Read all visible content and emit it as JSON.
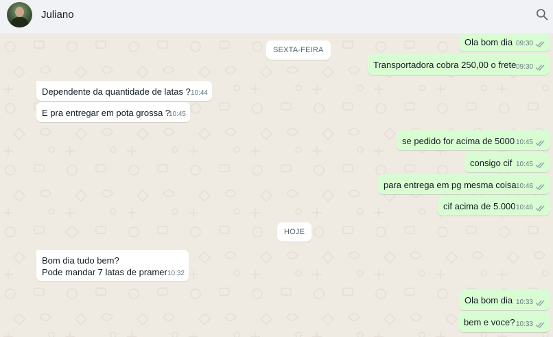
{
  "header": {
    "contact_name": "Juliano",
    "avatar_icon": "avatar-photo",
    "search_icon": "search-icon"
  },
  "colors": {
    "header_bg": "#f0f2f5",
    "chat_bg": "#efeae2",
    "incoming_bubble": "#ffffff",
    "outgoing_bubble": "#d9fdd3",
    "read_tick": "#8696a0"
  },
  "day_labels": {
    "friday": "SEXTA-FEIRA",
    "today": "HOJE"
  },
  "messages": [
    {
      "direction": "out",
      "text": "Ola bom dia",
      "time": "09:30",
      "status": "read"
    },
    {
      "direction": "out",
      "text": "Transportadora cobra 250,00 o frete",
      "time": "09:30",
      "status": "read"
    },
    {
      "direction": "in",
      "text": "Dependente da quantidade de latas ?",
      "time": "10:44"
    },
    {
      "direction": "in",
      "text": "E pra entregar em pota grossa ?",
      "time": "10:45"
    },
    {
      "direction": "out",
      "text": "se pedido for acima de 5000",
      "time": "10:45",
      "status": "read"
    },
    {
      "direction": "out",
      "text": "consigo cif",
      "time": "10:45",
      "status": "read"
    },
    {
      "direction": "out",
      "text": "para entrega em pg mesma coisa",
      "time": "10:46",
      "status": "read"
    },
    {
      "direction": "out",
      "text": "cif acima de 5.000",
      "time": "10:46",
      "status": "read"
    },
    {
      "direction": "in",
      "text": "Bom dia tudo bem?\nPode mandar 7 latas de pramer",
      "time": "10:32"
    },
    {
      "direction": "out",
      "text": "Ola bom dia",
      "time": "10:33",
      "status": "read"
    },
    {
      "direction": "out",
      "text": "bem e voce?",
      "time": "10:33",
      "status": "read"
    }
  ]
}
